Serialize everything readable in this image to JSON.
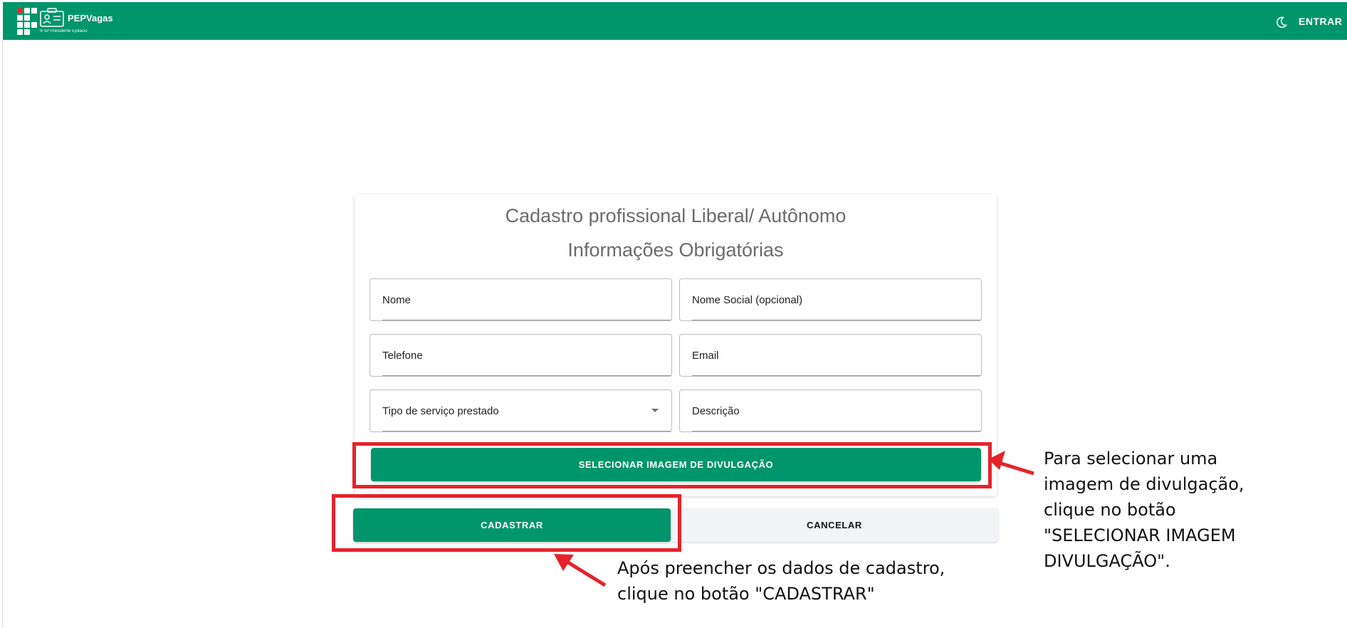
{
  "header": {
    "brand_name": "PEPVagas",
    "brand_subtitle": "IFSP Presidente Epitácio",
    "login_label": "ENTRAR",
    "theme_icon": "moon-icon",
    "background_color": "#00956a"
  },
  "form": {
    "title": "Cadastro profissional Liberal/ Autônomo",
    "subtitle": "Informações Obrigatórias",
    "fields": {
      "nome": "Nome",
      "nome_social": "Nome Social (opcional)",
      "telefone": "Telefone",
      "email": "Email",
      "tipo_servico": "Tipo de serviço prestado",
      "descricao": "Descrição"
    },
    "select_image_label": "SELECIONAR IMAGEM DE DIVULGAÇÃO",
    "submit_label": "CADASTRAR",
    "cancel_label": "CANCELAR"
  },
  "annotations": {
    "select_image_tip": [
      "Para selecionar uma",
      "imagem de divulgação,",
      "clique no botão",
      "\"SELECIONAR IMAGEM",
      "DIVULGAÇÃO\"."
    ],
    "submit_tip": [
      "Após preencher os dados de cadastro,",
      "clique no botão \"CADASTRAR\""
    ],
    "highlight_color": "#e5232b",
    "accent_color": "#00956a"
  }
}
